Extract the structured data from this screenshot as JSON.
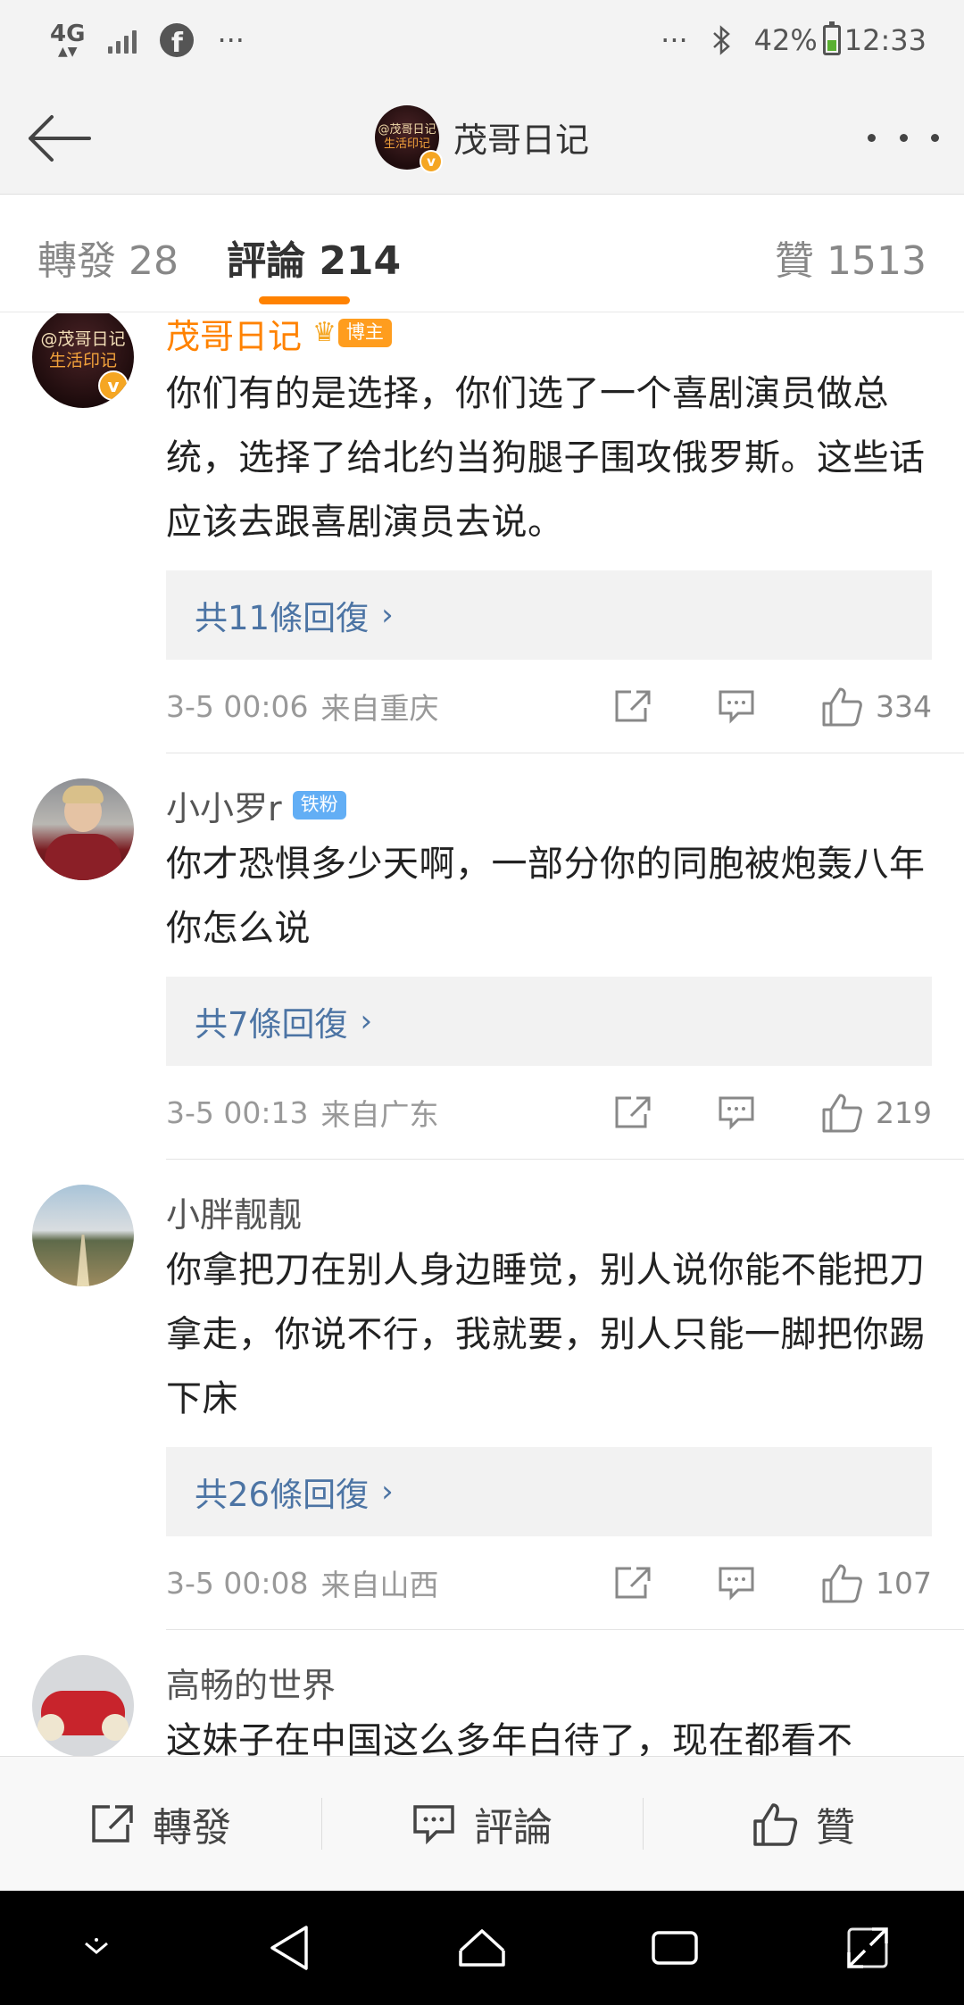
{
  "status_bar": {
    "network": "4G",
    "more": "···",
    "right_more": "···",
    "battery": "42%",
    "time": "12:33"
  },
  "header": {
    "avatar_text_line1": "@茂哥日记",
    "avatar_text_line2": "生活印记",
    "title": "茂哥日记"
  },
  "tabs": {
    "repost": "轉發 28",
    "comments": "評論 214",
    "likes": "贊 1513"
  },
  "comments": [
    {
      "name": "茂哥日记",
      "badge": "博主",
      "avatar_text_line1": "@茂哥日记",
      "avatar_text_line2": "生活印记",
      "text": "你们有的是选择，你们选了一个喜剧演员做总统，选择了给北约当狗腿子围攻俄罗斯。这些话应该去跟喜剧演员去说。",
      "replies": "共11條回復",
      "time": "3-5 00:06",
      "location": "来自重庆",
      "likes": "334"
    },
    {
      "name": "小小罗r",
      "badge": "铁粉",
      "text": "你才恐惧多少天啊，一部分你的同胞被炮轰八年你怎么说",
      "replies": "共7條回復",
      "time": "3-5 00:13",
      "location": "来自广东",
      "likes": "219"
    },
    {
      "name": "小胖靓靓",
      "text": "你拿把刀在别人身边睡觉，别人说你能不能把刀拿走，你说不行，我就要，别人只能一脚把你踢下床",
      "replies": "共26條回復",
      "time": "3-5 00:08",
      "location": "来自山西",
      "likes": "107"
    },
    {
      "name": "高畅的世界",
      "text": "这妹子在中国这么多年白待了，现在都看不"
    }
  ],
  "toolbar": {
    "repost": "轉發",
    "comment": "評論",
    "like": "贊"
  },
  "colors": {
    "accent": "#ff8200",
    "link": "#4c74a4",
    "author_name": "#ff8200",
    "fan_badge": "#62aef5"
  },
  "icons": [
    "back-arrow-icon",
    "more-dots-icon",
    "share-icon",
    "comment-icon",
    "like-icon",
    "chevron-right-icon",
    "crown-icon",
    "verified-v-icon"
  ]
}
